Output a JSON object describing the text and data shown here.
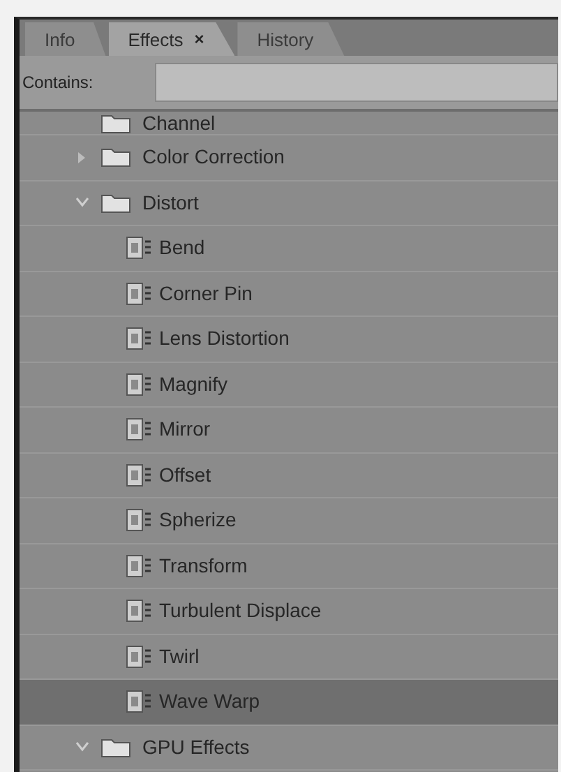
{
  "tabs": [
    {
      "label": "Info",
      "selected": false
    },
    {
      "label": "Effects",
      "selected": true,
      "close": "×"
    },
    {
      "label": "History",
      "selected": false
    }
  ],
  "search": {
    "label": "Contains:"
  },
  "tree": [
    {
      "label": "Channel",
      "kind": "folder",
      "selected": false
    },
    {
      "label": "Color Correction",
      "kind": "folder",
      "expanded": false,
      "selected": false
    },
    {
      "label": "Distort",
      "kind": "folder",
      "expanded": true,
      "selected": false,
      "children": [
        {
          "label": "Bend",
          "kind": "effect",
          "selected": false
        },
        {
          "label": "Corner Pin",
          "kind": "effect",
          "selected": false
        },
        {
          "label": "Lens Distortion",
          "kind": "effect",
          "selected": false
        },
        {
          "label": "Magnify",
          "kind": "effect",
          "selected": false
        },
        {
          "label": "Mirror",
          "kind": "effect",
          "selected": false
        },
        {
          "label": "Offset",
          "kind": "effect",
          "selected": false
        },
        {
          "label": "Spherize",
          "kind": "effect",
          "selected": false
        },
        {
          "label": "Transform",
          "kind": "effect",
          "selected": false
        },
        {
          "label": "Turbulent Displace",
          "kind": "effect",
          "selected": false
        },
        {
          "label": "Twirl",
          "kind": "effect",
          "selected": false
        },
        {
          "label": "Wave Warp",
          "kind": "effect",
          "selected": true
        }
      ]
    },
    {
      "label": "GPU Effects",
      "kind": "folder",
      "expanded": true,
      "selected": false
    }
  ]
}
